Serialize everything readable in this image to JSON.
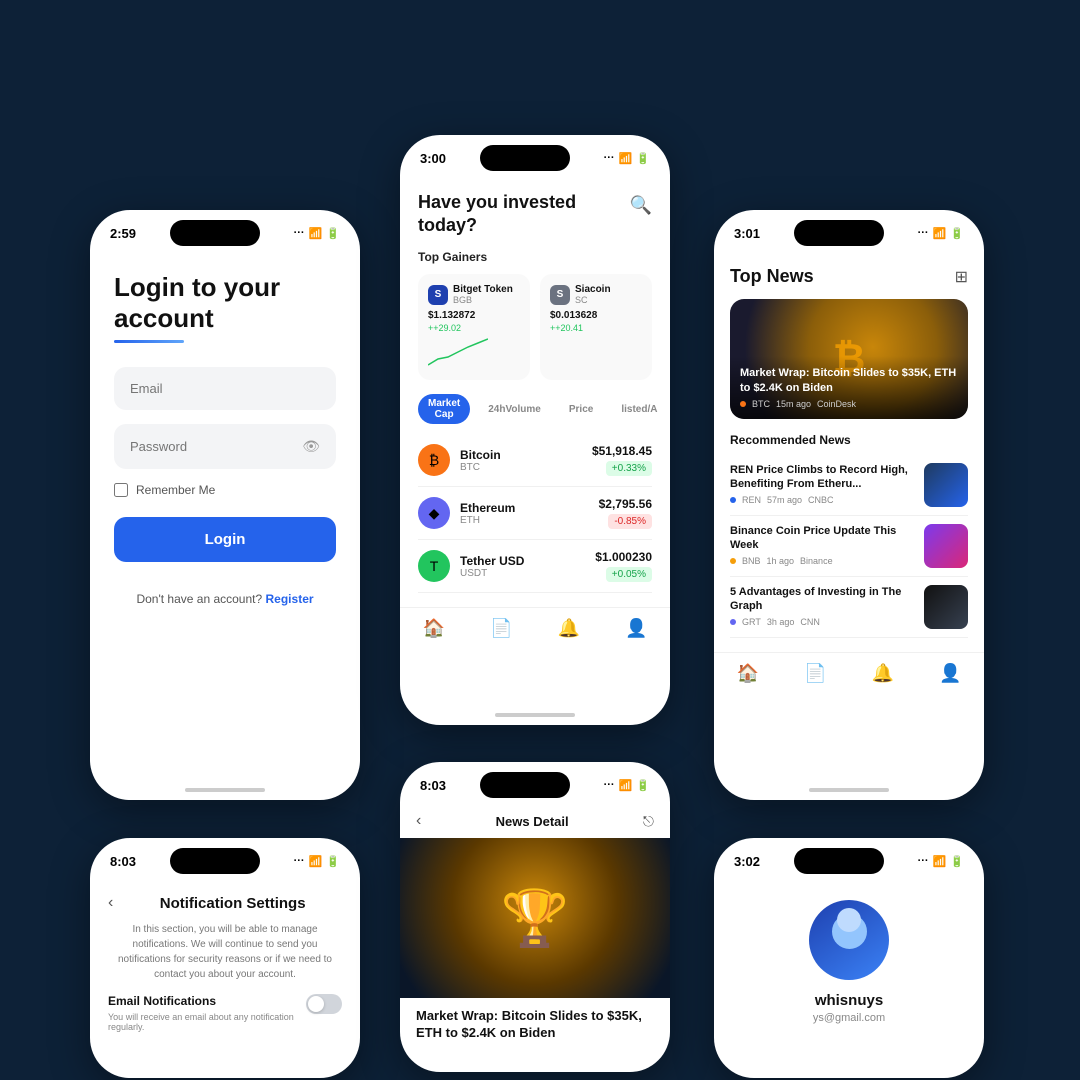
{
  "background": "#0d2137",
  "phone_login": {
    "time": "2:59",
    "title_line1": "Login to your",
    "title_line2": "account",
    "email_placeholder": "Email",
    "password_placeholder": "Password",
    "remember_label": "Remember Me",
    "login_button": "Login",
    "no_account_text": "Don't have an account?",
    "register_link": "Register"
  },
  "phone_market": {
    "time": "3:00",
    "heading": "Have you invested today?",
    "top_gainers_label": "Top Gainers",
    "gainer1": {
      "name": "Bitget Token",
      "symbol": "BGB",
      "price": "$1.132872",
      "change": "+29.02"
    },
    "gainer2": {
      "name": "Siacoin",
      "symbol": "SC",
      "price": "$0.013628",
      "change": "+20.41"
    },
    "tabs": [
      "Market Cap",
      "24hVolume",
      "Price",
      "listed/A"
    ],
    "coins": [
      {
        "name": "Bitcoin",
        "symbol": "BTC",
        "price": "$51,918.45",
        "change": "+0.33%",
        "positive": true
      },
      {
        "name": "Ethereum",
        "symbol": "ETH",
        "price": "$2,795.56",
        "change": "-0.85%",
        "positive": false
      },
      {
        "name": "Tether USD",
        "symbol": "USDT",
        "price": "$1.000230",
        "change": "+0.05%",
        "positive": true
      }
    ]
  },
  "phone_news": {
    "time": "3:01",
    "title": "Top News",
    "featured": {
      "headline": "Market Wrap: Bitcoin Slides to $35K, ETH to $2.4K on Biden",
      "coin": "BTC",
      "time_ago": "15m ago",
      "source": "CoinDesk"
    },
    "recommended_label": "Recommended News",
    "items": [
      {
        "headline": "REN Price Climbs to Record High, Benefiting From Etheru...",
        "coin": "REN",
        "time_ago": "57m ago",
        "source": "CNBC"
      },
      {
        "headline": "Binance Coin Price Update This Week",
        "coin": "BNB",
        "time_ago": "1h ago",
        "source": "Binance"
      },
      {
        "headline": "5 Advantages of Investing in The Graph",
        "coin": "GRT",
        "time_ago": "3h ago",
        "source": "CNN"
      }
    ]
  },
  "phone_notif": {
    "time": "8:03",
    "title": "Notification Settings",
    "description": "In this section, you will be able to manage notifications. We will continue to send you notifications for security reasons or if we need to contact you about your account.",
    "email_notif_label": "Email Notifications",
    "email_notif_desc": "You will receive an email about any notification regularly."
  },
  "phone_newsdetail": {
    "time": "8:03",
    "title": "News Detail",
    "headline": "Market Wrap: Bitcoin Slides to $35K, ETH to $2.4K on Biden"
  },
  "phone_profile": {
    "time": "3:02",
    "username": "whisnuys",
    "email": "ys@gmail.com"
  }
}
